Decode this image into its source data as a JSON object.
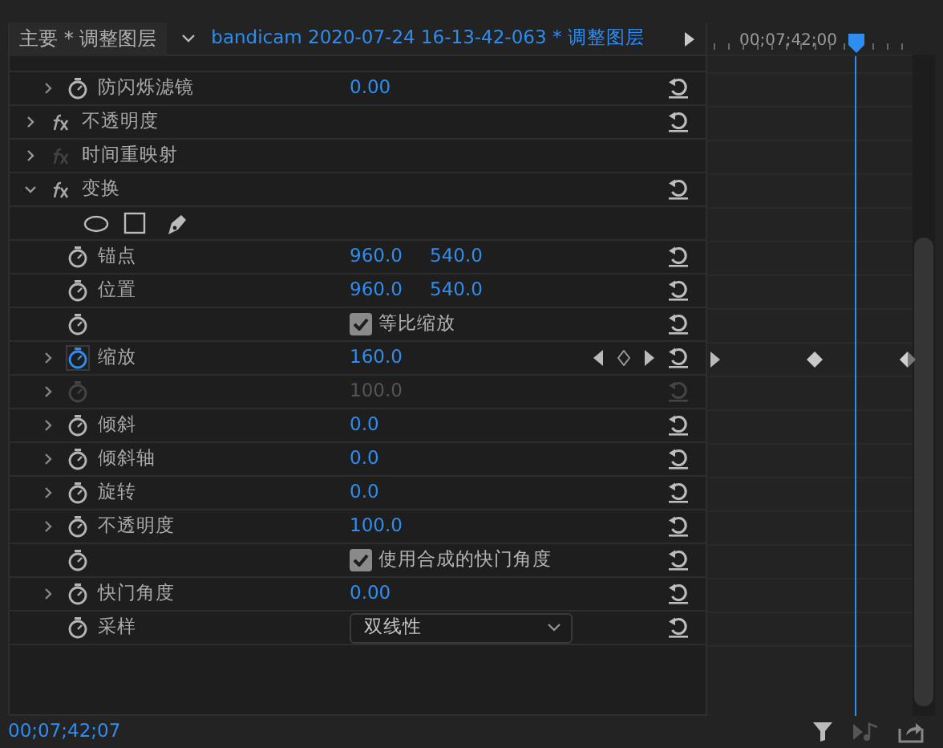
{
  "header": {
    "source_tab": "主要 * 调整图层",
    "clip_title": "bandicam  2020-07-24  16-13-42-063 * 调整图层",
    "timecode": "00;07;42;00"
  },
  "rows": [
    {
      "kind": "partial"
    },
    {
      "kind": "property",
      "label": "防闪烁滤镜",
      "expandable": true,
      "values": [
        "0.00"
      ],
      "animated": false,
      "disabled": false
    },
    {
      "kind": "effect",
      "label": "不透明度",
      "expanded": false,
      "enabled": true
    },
    {
      "kind": "effect",
      "label": "时间重映射",
      "expanded": false,
      "enabled": false
    },
    {
      "kind": "effect",
      "label": "变换",
      "expanded": true,
      "enabled": true
    },
    {
      "kind": "shapes"
    },
    {
      "kind": "property",
      "label": "锚点",
      "expandable": false,
      "values": [
        "960.0",
        "540.0"
      ],
      "animated": false,
      "disabled": false
    },
    {
      "kind": "property",
      "label": "位置",
      "expandable": false,
      "values": [
        "960.0",
        "540.0"
      ],
      "animated": false,
      "disabled": false
    },
    {
      "kind": "checkbox",
      "text": "等比缩放",
      "checked": true
    },
    {
      "kind": "property",
      "label": "缩放",
      "expandable": true,
      "values": [
        "160.0"
      ],
      "animated": true,
      "disabled": false
    },
    {
      "kind": "property",
      "label": "",
      "expandable": true,
      "values": [
        "100.0"
      ],
      "animated": false,
      "disabled": true
    },
    {
      "kind": "property",
      "label": "倾斜",
      "expandable": true,
      "values": [
        "0.0"
      ],
      "animated": false,
      "disabled": false
    },
    {
      "kind": "property",
      "label": "倾斜轴",
      "expandable": true,
      "values": [
        "0.0"
      ],
      "animated": false,
      "disabled": false
    },
    {
      "kind": "property",
      "label": "旋转",
      "expandable": true,
      "values": [
        "0.0"
      ],
      "animated": false,
      "disabled": false
    },
    {
      "kind": "property",
      "label": "不透明度",
      "expandable": true,
      "values": [
        "100.0"
      ],
      "animated": false,
      "disabled": false
    },
    {
      "kind": "checkbox",
      "text": "使用合成的快门角度",
      "checked": true
    },
    {
      "kind": "property",
      "label": "快门角度",
      "expandable": true,
      "values": [
        "0.00"
      ],
      "animated": false,
      "disabled": false
    },
    {
      "kind": "dropdown",
      "label": "采样",
      "value": "双线性"
    }
  ],
  "status_bar": {
    "timecode": "00;07;42;07"
  }
}
